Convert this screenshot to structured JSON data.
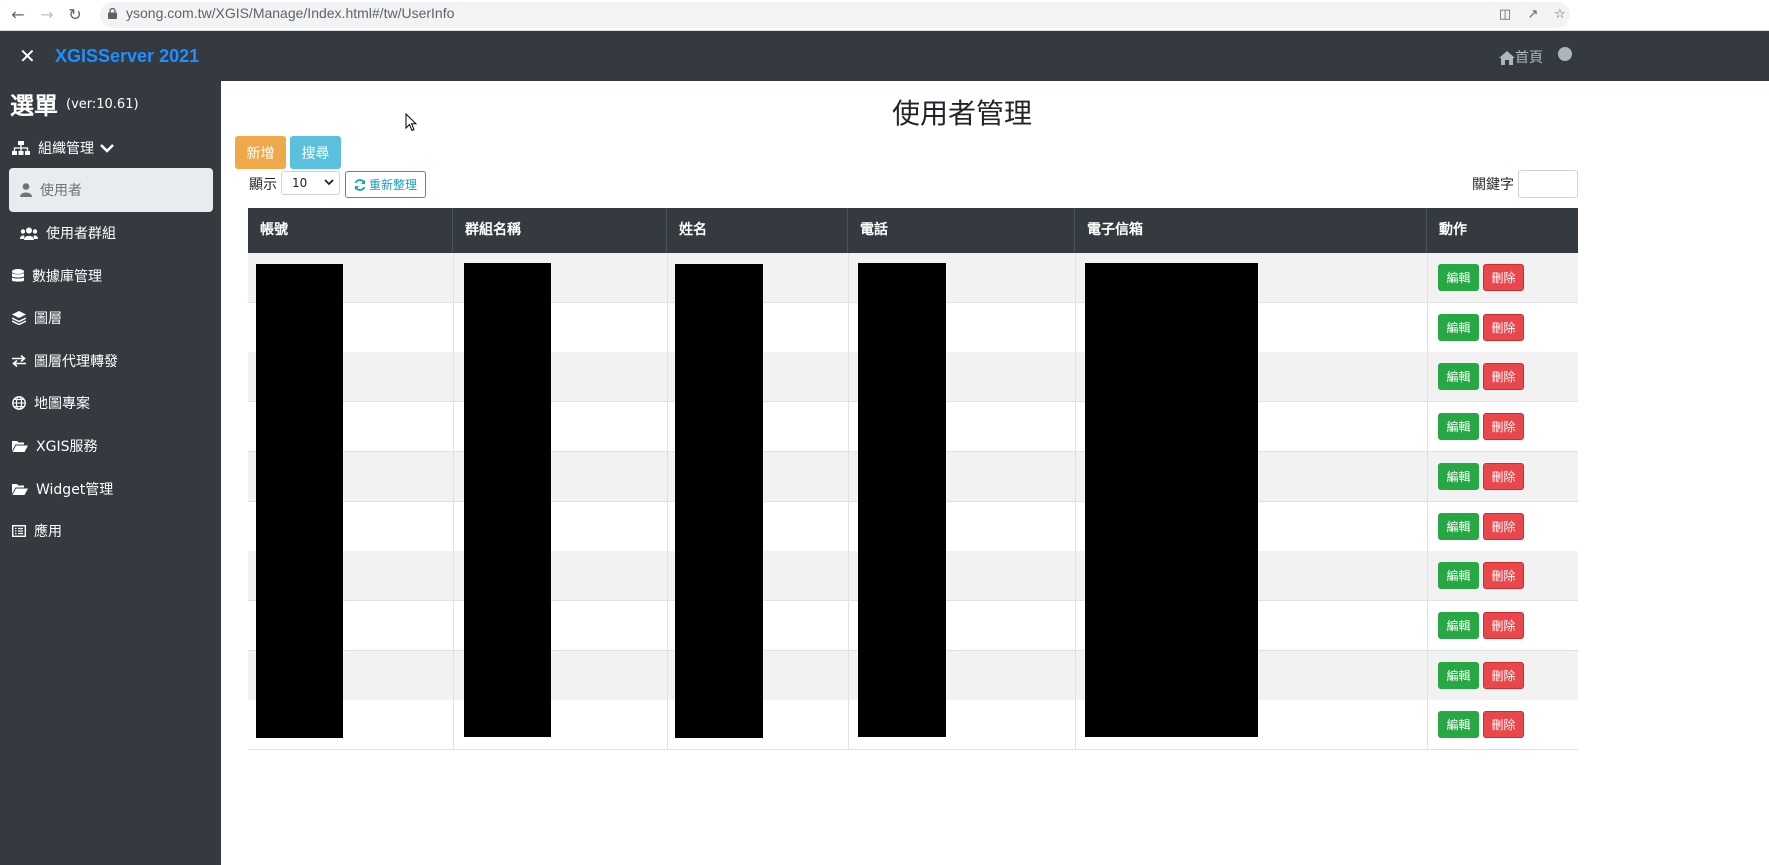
{
  "browser": {
    "url": "ysong.com.tw/XGIS/Manage/Index.html#/tw/UserInfo"
  },
  "app": {
    "brand": "XGISServer 2021",
    "home_label": "首頁"
  },
  "sidebar": {
    "title": "選單",
    "version": "(ver:10.61)",
    "items": [
      {
        "label": "組織管理",
        "icon": "sitemap-icon"
      },
      {
        "label": "使用者",
        "icon": "user-icon",
        "active": true
      },
      {
        "label": "使用者群組",
        "icon": "users-icon"
      },
      {
        "label": "數據庫管理",
        "icon": "database-icon"
      },
      {
        "label": "圖層",
        "icon": "layers-icon"
      },
      {
        "label": "圖層代理轉發",
        "icon": "exchange-icon"
      },
      {
        "label": "地圖專案",
        "icon": "globe-icon"
      },
      {
        "label": "XGIS服務",
        "icon": "folder-open-icon"
      },
      {
        "label": "Widget管理",
        "icon": "folder-open-icon"
      },
      {
        "label": "應用",
        "icon": "list-icon"
      }
    ]
  },
  "main": {
    "title": "使用者管理",
    "add_label": "新增",
    "search_label": "搜尋",
    "show_label": "顯示",
    "page_size": "10",
    "refresh_label": "重新整理",
    "keyword_label": "關鍵字",
    "columns": [
      "帳號",
      "群組名稱",
      "姓名",
      "電話",
      "電子信箱",
      "動作"
    ],
    "edit_label": "編輯",
    "delete_label": "刪除"
  },
  "colors": {
    "topbar": "#343a40",
    "brand": "#1e90ff",
    "add": "#f0a94a",
    "search": "#5bc0de",
    "edit": "#28a745",
    "delete": "#e9474c"
  }
}
